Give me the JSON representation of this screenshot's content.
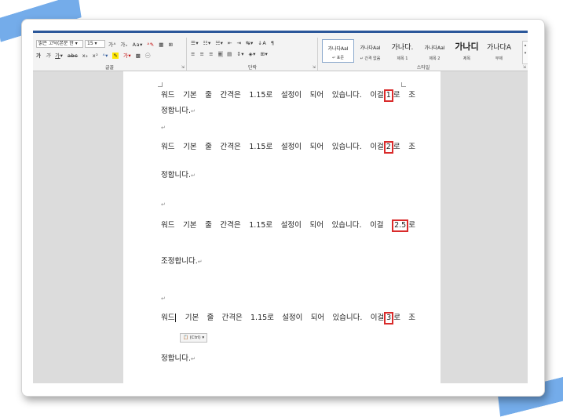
{
  "ribbon": {
    "font_group": {
      "label": "글꼴",
      "font_name": "맑은 고딕(본문 한",
      "font_size": "15"
    },
    "paragraph_group": {
      "label": "단락"
    },
    "styles_group": {
      "label": "스타일",
      "items": [
        {
          "sample": "가나다AaI",
          "name": "↵ 표준"
        },
        {
          "sample": "가나다AaI",
          "name": "↵ 간격 없음"
        },
        {
          "sample": "가나다.",
          "name": "제목 1"
        },
        {
          "sample": "가나다AaI",
          "name": "제목 2"
        },
        {
          "sample": "가나디",
          "name": "제목"
        },
        {
          "sample": "가나다A",
          "name": "부제"
        }
      ]
    }
  },
  "document": {
    "paragraph_mark": "↵",
    "blocks": [
      {
        "line1": [
          "워드",
          "기본",
          "줄",
          "간격은",
          "1.15로",
          "설정이",
          "되어",
          "있습니다.",
          "이걸",
          "1",
          "로",
          "조"
        ],
        "line2": "정합니다."
      },
      {
        "line1": [
          "워드",
          "기본",
          "줄",
          "간격은",
          "1.15로",
          "설정이",
          "되어",
          "있습니다.",
          "이걸",
          "2",
          "로",
          "조"
        ],
        "line2": "정합니다."
      },
      {
        "line1": [
          "워드",
          "기본",
          "줄",
          "간격은",
          "1.15로",
          "설정이",
          "되어",
          "있습니다.",
          "이걸",
          "2.5",
          "로"
        ],
        "line2": "조정합니다."
      },
      {
        "line1": [
          "워드",
          "기본",
          "줄",
          "간격은",
          "1.15로",
          "설정이",
          "되어",
          "있습니다.",
          "이걸",
          "3",
          "로",
          "조"
        ],
        "line2": "정합니다."
      }
    ],
    "paste_options_label": "(Ctrl) ▾"
  }
}
